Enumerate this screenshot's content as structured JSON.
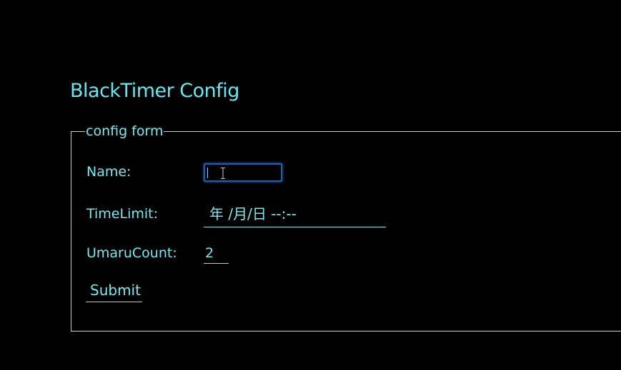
{
  "page": {
    "title": "BlackTimer Config"
  },
  "form": {
    "legend": "config form",
    "name": {
      "label": "Name:",
      "value": ""
    },
    "time_limit": {
      "label": "TimeLimit:",
      "placeholder": "年 /月/日 --:--"
    },
    "umaru_count": {
      "label": "UmaruCount:",
      "value": "2"
    },
    "submit_label": "Submit"
  },
  "colors": {
    "background": "#000000",
    "accent": "#7fe6ef",
    "focus_border": "#1a5fb0",
    "fieldset_border": "#cfcfcf"
  },
  "icons": {
    "cursor": "text-cursor-icon"
  }
}
